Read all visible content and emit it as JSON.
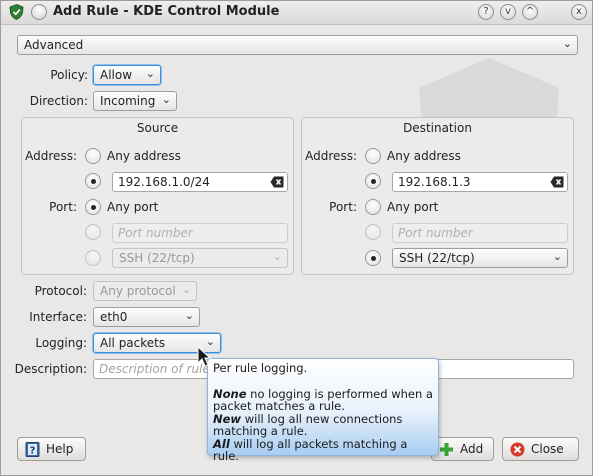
{
  "window": {
    "title": "Add Rule - KDE Control Module",
    "help_button": "?",
    "min_button": "v",
    "max_button": "^",
    "close_button": "x"
  },
  "mode_select": {
    "value": "Advanced"
  },
  "policy": {
    "label": "Policy:",
    "value": "Allow"
  },
  "direction": {
    "label": "Direction:",
    "value": "Incoming"
  },
  "source": {
    "title": "Source",
    "address_label": "Address:",
    "any_address": "Any address",
    "address_value": "192.168.1.0/24",
    "port_label": "Port:",
    "any_port": "Any port",
    "port_placeholder": "Port number",
    "service_value": "SSH (22/tcp)"
  },
  "destination": {
    "title": "Destination",
    "address_label": "Address:",
    "any_address": "Any address",
    "address_value": "192.168.1.3",
    "port_label": "Port:",
    "any_port": "Any port",
    "port_placeholder": "Port number",
    "service_value": "SSH (22/tcp)"
  },
  "protocol": {
    "label": "Protocol:",
    "value": "Any protocol"
  },
  "interface": {
    "label": "Interface:",
    "value": "eth0"
  },
  "logging": {
    "label": "Logging:",
    "value": "All packets"
  },
  "description": {
    "label": "Description:",
    "placeholder": "Description of rule"
  },
  "tooltip": {
    "line1": "Per rule logging.",
    "none_kw": "None",
    "none_text": " no logging is performed when a packet matches a rule.",
    "new_kw": "New",
    "new_text": " will log all new connections matching a rule.",
    "all_kw": "All",
    "all_text": " will log all packets matching a rule."
  },
  "buttons": {
    "help": "Help",
    "add": "Add",
    "close": "Close"
  },
  "colors": {
    "accent": "#3f8ed8",
    "add_icon": "#3aa335",
    "close_icon": "#d23a2e",
    "tooltip_bottom": "#a8cdf2"
  }
}
